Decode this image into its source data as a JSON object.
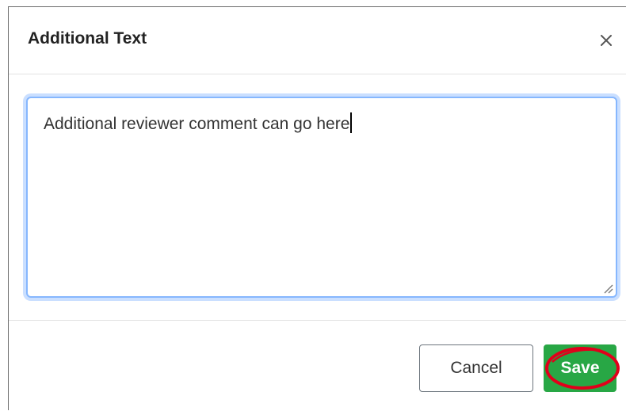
{
  "dialog": {
    "title": "Additional Text",
    "close_icon": "close-icon"
  },
  "textarea": {
    "value": "Additional reviewer comment can go here",
    "focused": true
  },
  "footer": {
    "cancel_label": "Cancel",
    "save_label": "Save"
  },
  "colors": {
    "save_button": "#28a745",
    "focus_border": "#86b7fe",
    "annotation_ring": "#e0001b"
  }
}
